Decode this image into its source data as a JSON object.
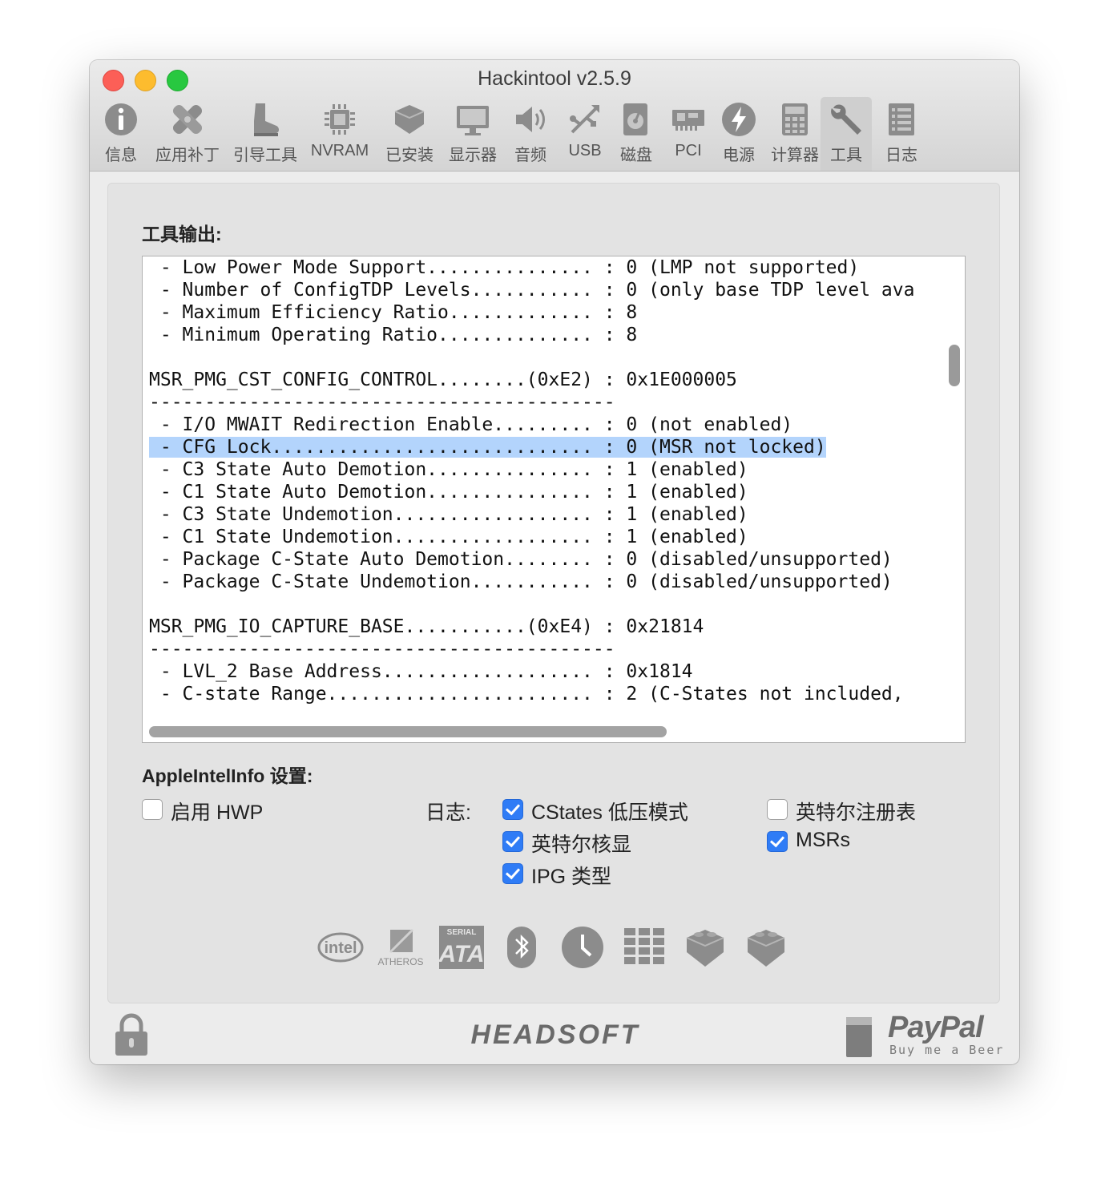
{
  "window": {
    "title": "Hackintool v2.5.9"
  },
  "toolbar": {
    "items": [
      {
        "label": "信息",
        "icon": "info-icon"
      },
      {
        "label": "应用补丁",
        "icon": "patch-icon"
      },
      {
        "label": "引导工具",
        "icon": "boot-icon"
      },
      {
        "label": "NVRAM",
        "icon": "chip-icon"
      },
      {
        "label": "已安装",
        "icon": "kext-icon"
      },
      {
        "label": "显示器",
        "icon": "display-icon"
      },
      {
        "label": "音频",
        "icon": "speaker-icon"
      },
      {
        "label": "USB",
        "icon": "usb-icon"
      },
      {
        "label": "磁盘",
        "icon": "disk-icon"
      },
      {
        "label": "PCI",
        "icon": "pci-icon"
      },
      {
        "label": "电源",
        "icon": "power-icon"
      },
      {
        "label": "计算器",
        "icon": "calculator-icon"
      },
      {
        "label": "工具",
        "icon": "wrench-icon"
      },
      {
        "label": "日志",
        "icon": "log-icon"
      }
    ],
    "active": "工具"
  },
  "tools": {
    "output_label": "工具输出:",
    "output_lines": [
      " - Low Power Mode Support............... : 0 (LMP not supported)",
      " - Number of ConfigTDP Levels........... : 0 (only base TDP level ava",
      " - Maximum Efficiency Ratio............. : 8",
      " - Minimum Operating Ratio.............. : 8",
      "",
      "MSR_PMG_CST_CONFIG_CONTROL........(0xE2) : 0x1E000005",
      "------------------------------------------",
      " - I/O MWAIT Redirection Enable......... : 0 (not enabled)",
      " - CFG Lock............................. : 0 (MSR not locked)",
      " - C3 State Auto Demotion............... : 1 (enabled)",
      " - C1 State Auto Demotion............... : 1 (enabled)",
      " - C3 State Undemotion.................. : 1 (enabled)",
      " - C1 State Undemotion.................. : 1 (enabled)",
      " - Package C-State Auto Demotion........ : 0 (disabled/unsupported)",
      " - Package C-State Undemotion........... : 0 (disabled/unsupported)",
      "",
      "MSR_PMG_IO_CAPTURE_BASE...........(0xE4) : 0x21814",
      "------------------------------------------",
      " - LVL_2 Base Address................... : 0x1814",
      " - C-state Range........................ : 2 (C-States not included,"
    ],
    "highlighted_line": 8
  },
  "settings": {
    "label": "AppleIntelInfo 设置:",
    "log_label": "日志:",
    "enable_hwp": {
      "label": "启用 HWP",
      "checked": false
    },
    "cstates_lfm": {
      "label": "CStates 低压模式",
      "checked": true
    },
    "intel_igpu": {
      "label": "英特尔核显",
      "checked": true
    },
    "ipg_type": {
      "label": "IPG 类型",
      "checked": true
    },
    "intel_registers": {
      "label": "英特尔注册表",
      "checked": false
    },
    "msrs": {
      "label": "MSRs",
      "checked": true
    }
  },
  "logos": [
    "intel-logo",
    "atheros-logo",
    "serial-ata-logo",
    "bluetooth-icon",
    "clock-icon",
    "grid-icon",
    "lego-brick-icon",
    "lego-brick-icon"
  ],
  "logo_text": {
    "intel": "intel",
    "atheros": "ATHEROS",
    "sata_top": "SERIAL",
    "sata_main": "ATA"
  },
  "footer": {
    "brand": "HEADSOFT",
    "paypal_title": "PayPal",
    "paypal_sub": "Buy me a Beer"
  },
  "colors": {
    "accent": "#2f7cf6",
    "highlight": "#b3d4fc",
    "close": "#fc5f57",
    "minimize": "#fdbc2e",
    "maximize": "#28c840"
  }
}
